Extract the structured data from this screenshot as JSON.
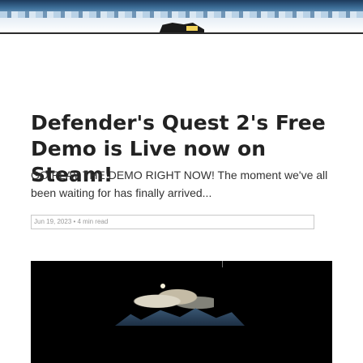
{
  "article": {
    "title": "Defender's Quest 2's Free Demo is Live now on Steam!",
    "excerpt": "GO PLAY THE DEMO RIGHT NOW! The moment we've all been waiting for has finally arrived...",
    "meta": "Jun 19, 2023 • 4 min read"
  },
  "icons": {
    "hero": "hero-banner-image",
    "thumbnail": "thumbnail-image"
  }
}
